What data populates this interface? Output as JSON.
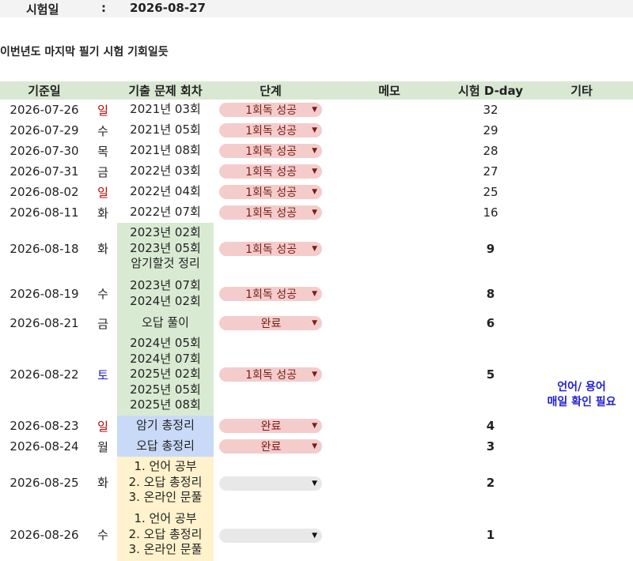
{
  "header": {
    "exam_label": "시험일",
    "colon": ":",
    "exam_date": "2026-08-27"
  },
  "subtitle": "이번년도 마지막 필기 시험 기회일듯",
  "columns": [
    "기준일",
    "",
    "기출 문제 회차",
    "단계",
    "메모",
    "시험 D-day",
    "기타"
  ],
  "rows": [
    {
      "date": "2026-07-26",
      "dow": "일",
      "round": "2021년 03회",
      "stage": "1회독 성공",
      "dday": "32"
    },
    {
      "date": "2026-07-29",
      "dow": "수",
      "round": "2021년 05회",
      "stage": "1회독 성공",
      "dday": "29"
    },
    {
      "date": "2026-07-30",
      "dow": "목",
      "round": "2021년 08회",
      "stage": "1회독 성공",
      "dday": "28"
    },
    {
      "date": "2026-07-31",
      "dow": "금",
      "round": "2022년 03회",
      "stage": "1회독 성공",
      "dday": "27"
    },
    {
      "date": "2026-08-02",
      "dow": "일",
      "round": "2022년 04회",
      "stage": "1회독 성공",
      "dday": "25"
    },
    {
      "date": "2026-08-11",
      "dow": "화",
      "round": "2022년 07회",
      "stage": "1회독 성공",
      "dday": "16"
    },
    {
      "date": "2026-08-18",
      "dow": "화",
      "round": "2023년 02회\n2023년 05회\n암기할것 정리",
      "stage": "1회독 성공",
      "dday": "9"
    },
    {
      "date": "2026-08-19",
      "dow": "수",
      "round": "2023년 07회\n2024년 02회",
      "stage": "1회독 성공",
      "dday": "8"
    },
    {
      "date": "2026-08-21",
      "dow": "금",
      "round": "오답 풀이",
      "stage": "완료",
      "dday": "6"
    },
    {
      "date": "2026-08-22",
      "dow": "토",
      "round": "2024년 05회\n2024년 07회\n2025년 02회\n2025년 05회\n2025년 08회",
      "stage": "1회독 성공",
      "dday": "5"
    },
    {
      "date": "2026-08-23",
      "dow": "일",
      "round": "암기 총정리",
      "stage": "완료",
      "dday": "4"
    },
    {
      "date": "2026-08-24",
      "dow": "월",
      "round": "오답 총정리",
      "stage": "완료",
      "dday": "3"
    },
    {
      "date": "2026-08-25",
      "dow": "화",
      "round": "1. 언어 공부\n2. 오답 총정리\n3. 온라인 문풀",
      "stage": "",
      "dday": "2"
    },
    {
      "date": "2026-08-26",
      "dow": "수",
      "round": "1. 언어 공부\n2. 오답 총정리\n3. 온라인 문풀",
      "stage": "",
      "dday": "1"
    }
  ],
  "etc_note": "언어/ 용어\n매일 확인 필요",
  "icons": {
    "dropdown": "dropdown-arrow-icon"
  },
  "colors": {
    "header_bg": "#d9e8d2",
    "round_green": "#d9ead3",
    "round_blue": "#c9daf8",
    "round_yellow": "#fff2cc",
    "chip_pink": "#f4cccc",
    "chip_gray": "#e8e8e8",
    "sunday_red": "#c00000",
    "saturday_blue": "#1f1fd1",
    "note_blue": "#1f1fd1"
  }
}
